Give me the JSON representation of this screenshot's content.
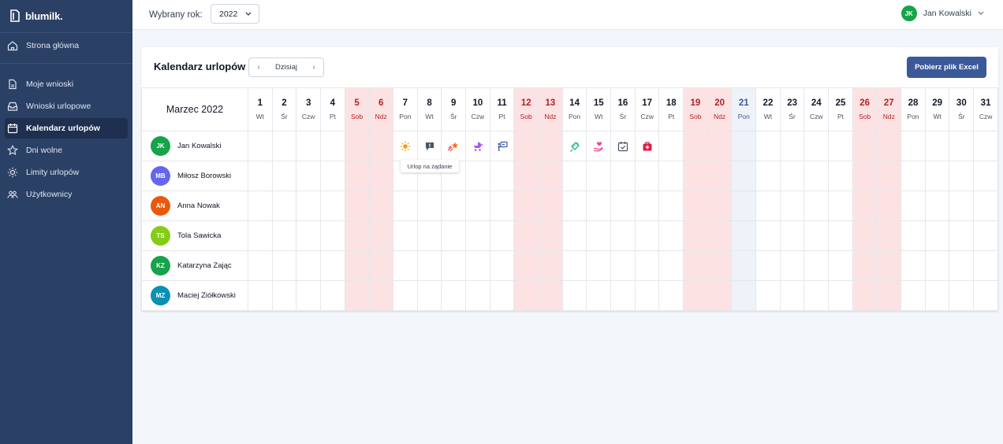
{
  "app": {
    "logo_text": "blumilk."
  },
  "sidebar": {
    "items": [
      {
        "label": "Strona główna",
        "icon": "home-icon"
      },
      {
        "label": "Moje wnioski",
        "icon": "document-icon"
      },
      {
        "label": "Wnioski urlopowe",
        "icon": "inbox-icon"
      },
      {
        "label": "Kalendarz urlopów",
        "icon": "calendar-icon",
        "active": true
      },
      {
        "label": "Dni wolne",
        "icon": "star-icon"
      },
      {
        "label": "Limity urlopów",
        "icon": "sun-icon"
      },
      {
        "label": "Użytkownicy",
        "icon": "users-icon"
      }
    ]
  },
  "topbar": {
    "year_label": "Wybrany rok:",
    "year_value": "2022",
    "user_name": "Jan Kowalski",
    "user_initials": "JK",
    "user_color": "#16a34a"
  },
  "calendar": {
    "title": "Kalendarz urlopów",
    "today_label": "Dzisiaj",
    "excel_label": "Pobierz plik Excel",
    "month_label": "Marzec 2022",
    "days": [
      {
        "n": "1",
        "d": "Wt",
        "t": "w"
      },
      {
        "n": "2",
        "d": "Śr",
        "t": "w"
      },
      {
        "n": "3",
        "d": "Czw",
        "t": "w"
      },
      {
        "n": "4",
        "d": "Pt",
        "t": "w"
      },
      {
        "n": "5",
        "d": "Sob",
        "t": "we"
      },
      {
        "n": "6",
        "d": "Ndz",
        "t": "we"
      },
      {
        "n": "7",
        "d": "Pon",
        "t": "w"
      },
      {
        "n": "8",
        "d": "Wt",
        "t": "w"
      },
      {
        "n": "9",
        "d": "Śr",
        "t": "w"
      },
      {
        "n": "10",
        "d": "Czw",
        "t": "w"
      },
      {
        "n": "11",
        "d": "Pt",
        "t": "w"
      },
      {
        "n": "12",
        "d": "Sob",
        "t": "we"
      },
      {
        "n": "13",
        "d": "Ndz",
        "t": "we"
      },
      {
        "n": "14",
        "d": "Pon",
        "t": "w"
      },
      {
        "n": "15",
        "d": "Wt",
        "t": "w"
      },
      {
        "n": "16",
        "d": "Śr",
        "t": "w"
      },
      {
        "n": "17",
        "d": "Czw",
        "t": "w"
      },
      {
        "n": "18",
        "d": "Pt",
        "t": "w"
      },
      {
        "n": "19",
        "d": "Sob",
        "t": "we"
      },
      {
        "n": "20",
        "d": "Ndz",
        "t": "we"
      },
      {
        "n": "21",
        "d": "Pon",
        "t": "today"
      },
      {
        "n": "22",
        "d": "Wt",
        "t": "w"
      },
      {
        "n": "23",
        "d": "Śr",
        "t": "w"
      },
      {
        "n": "24",
        "d": "Czw",
        "t": "w"
      },
      {
        "n": "25",
        "d": "Pt",
        "t": "w"
      },
      {
        "n": "26",
        "d": "Sob",
        "t": "we"
      },
      {
        "n": "27",
        "d": "Ndz",
        "t": "we"
      },
      {
        "n": "28",
        "d": "Pon",
        "t": "w"
      },
      {
        "n": "29",
        "d": "Wt",
        "t": "w"
      },
      {
        "n": "30",
        "d": "Śr",
        "t": "w"
      },
      {
        "n": "31",
        "d": "Czw",
        "t": "w"
      }
    ],
    "users": [
      {
        "name": "Jan Kowalski",
        "initials": "JK",
        "color": "#16a34a",
        "vacations": {
          "7": "sun-icon",
          "8": "exclamation-bubble-icon",
          "9": "shooting-star-icon",
          "10": "baby-stroller-icon",
          "11": "caretaker-icon",
          "14": "syringe-icon",
          "15": "heart-hand-icon",
          "16": "calendar-check-icon",
          "17": "medical-kit-icon"
        }
      },
      {
        "name": "Miłosz Borowski",
        "initials": "MB",
        "color": "#6366f1",
        "vacations": {}
      },
      {
        "name": "Anna Nowak",
        "initials": "AN",
        "color": "#ea580c",
        "vacations": {}
      },
      {
        "name": "Tola Sawicka",
        "initials": "TS",
        "color": "#84cc16",
        "vacations": {}
      },
      {
        "name": "Katarzyna Zając",
        "initials": "KZ",
        "color": "#16a34a",
        "vacations": {}
      },
      {
        "name": "Maciej Ziółkowski",
        "initials": "MZ",
        "color": "#0891b2",
        "vacations": {}
      }
    ],
    "tooltip": "Urlop na żądanie"
  }
}
